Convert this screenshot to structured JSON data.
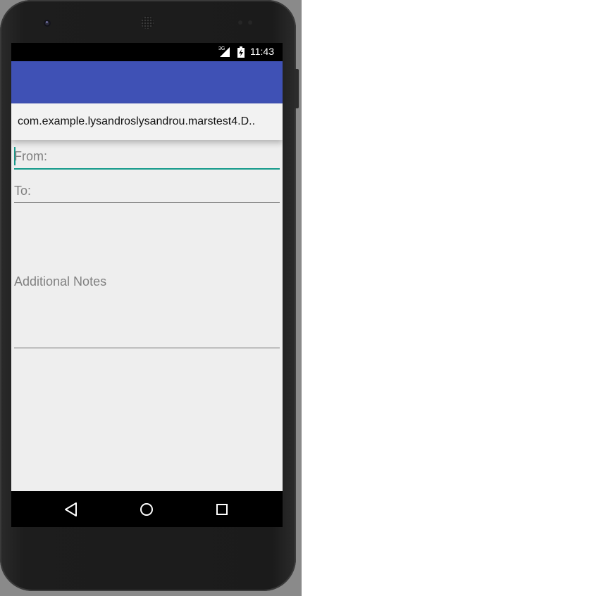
{
  "status_bar": {
    "network": "3G",
    "time": "11:43"
  },
  "app_bar": {
    "color": "#3f51b5"
  },
  "title_dropdown": {
    "text": "com.example.lysandroslysandrou.marstest4.D.."
  },
  "form": {
    "from_placeholder": "From:",
    "to_placeholder": "To:",
    "notes_placeholder": "Additional Notes",
    "accent_color": "#159a8a"
  },
  "nav_bar": {
    "back_icon": "back-triangle",
    "home_icon": "home-circle",
    "recents_icon": "recents-square"
  }
}
